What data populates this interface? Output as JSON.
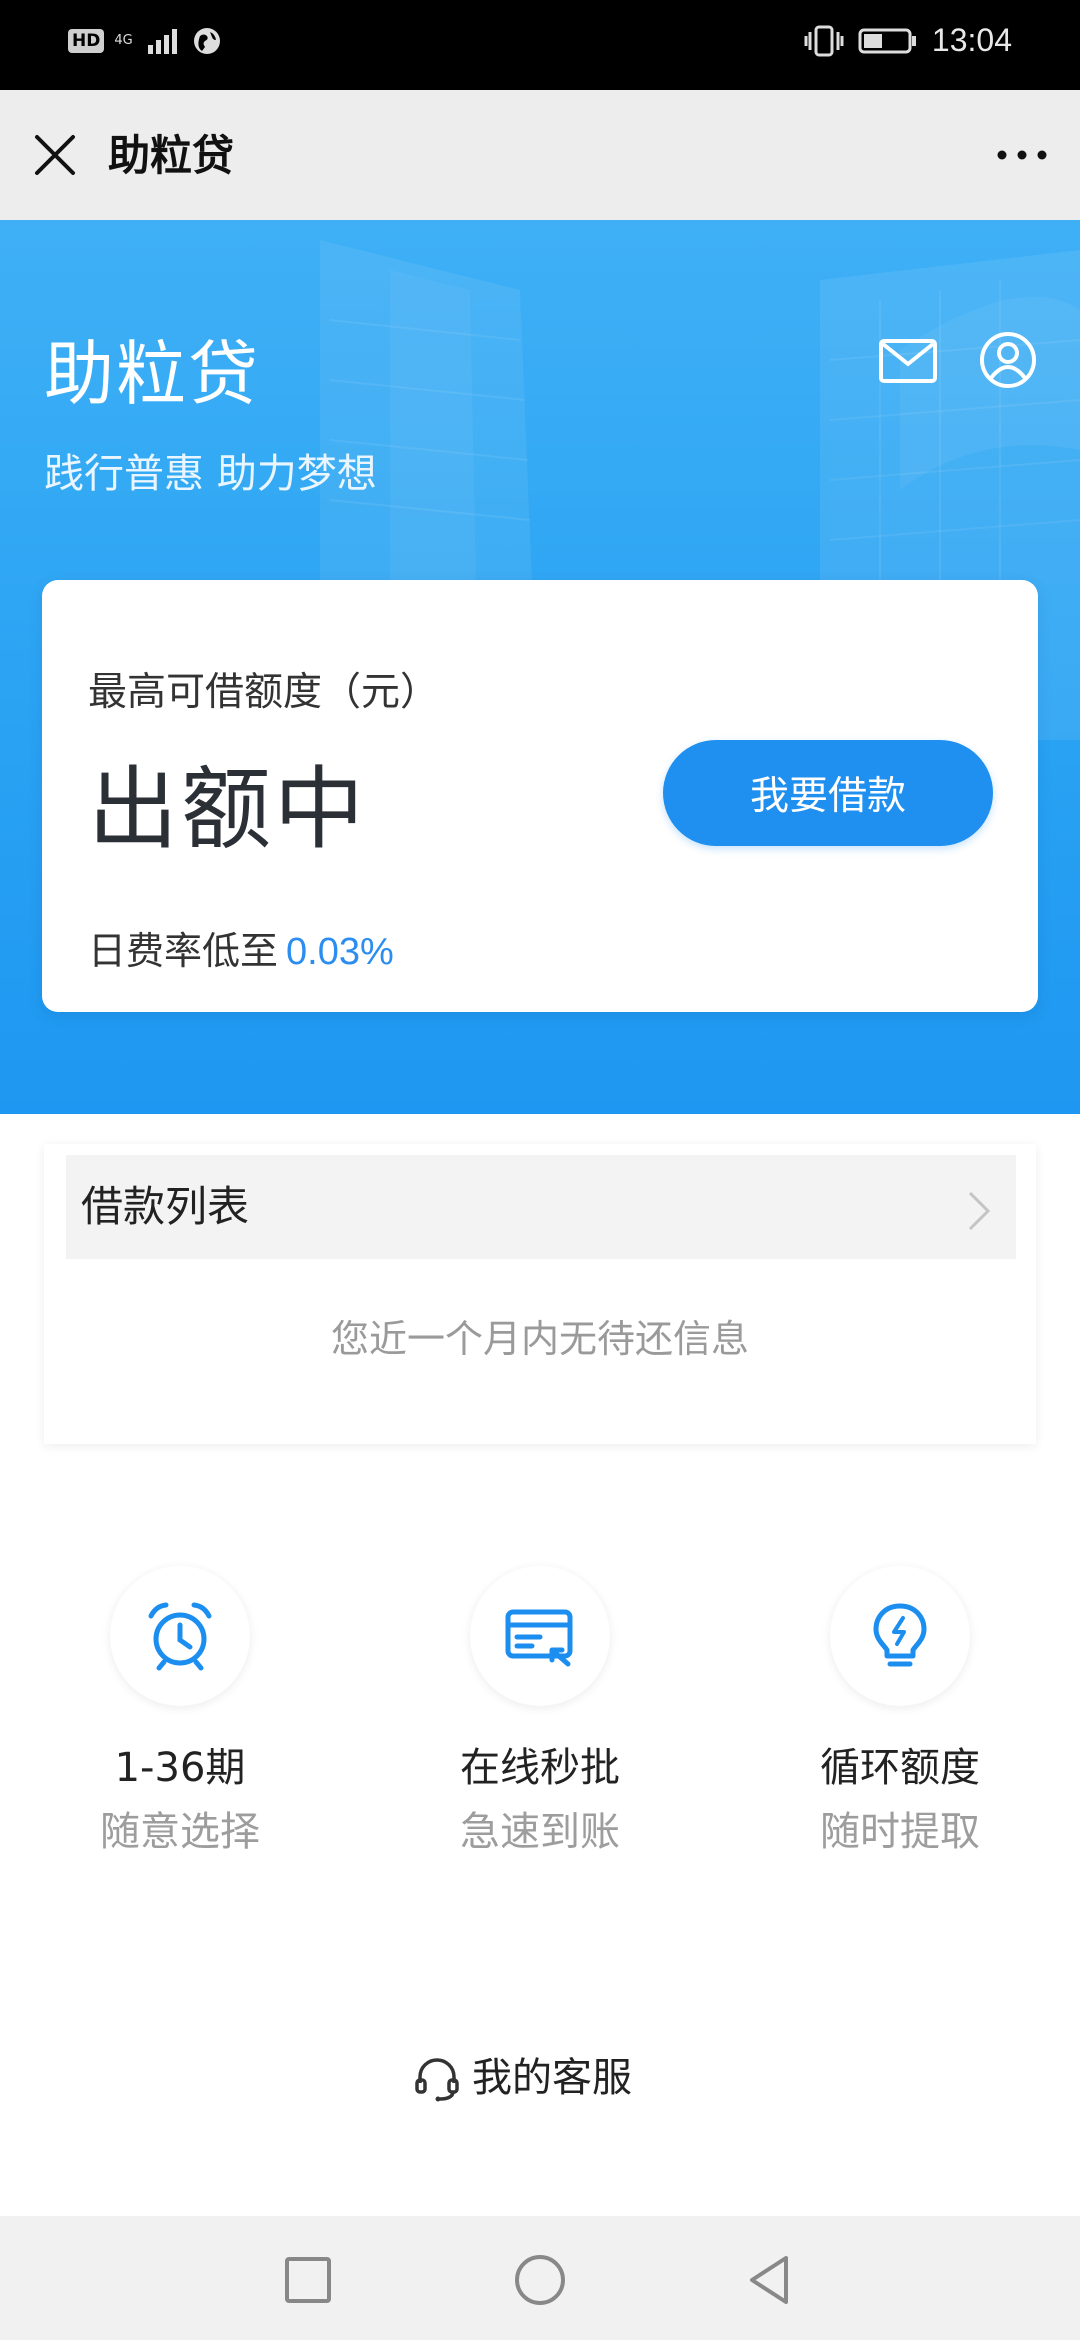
{
  "status_bar": {
    "hd_badge": "HD",
    "network_type": "4G",
    "time": "13:04"
  },
  "title_bar": {
    "title": "助粒贷"
  },
  "hero": {
    "title": "助粒贷",
    "subtitle": "践行普惠 助力梦想",
    "accent_color": "#2aa3f3"
  },
  "credit": {
    "label": "最高可借额度（元）",
    "value": "出额中",
    "borrow_button": "我要借款",
    "rate_label": "日费率低至",
    "rate_value": "0.03%"
  },
  "loan_list": {
    "header": "借款列表",
    "empty_message": "您近一个月内无待还信息"
  },
  "features": [
    {
      "icon": "alarm-clock-icon",
      "title": "1-36期",
      "desc": "随意选择"
    },
    {
      "icon": "card-approval-icon",
      "title": "在线秒批",
      "desc": "急速到账"
    },
    {
      "icon": "lightbulb-icon",
      "title": "循环额度",
      "desc": "随时提取"
    }
  ],
  "service": {
    "label": "我的客服"
  },
  "colors": {
    "primary_blue": "#1f8ff0",
    "rate_blue": "#2b8df0",
    "icon_blue": "#1c8ef0"
  }
}
